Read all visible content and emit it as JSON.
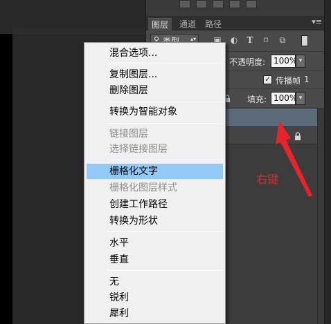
{
  "panel": {
    "tabs": [
      {
        "label": "图层",
        "active": true
      },
      {
        "label": "通道",
        "active": false
      },
      {
        "label": "路径",
        "active": false
      }
    ],
    "menu_glyph": "▾≡",
    "filter": {
      "selected": "类型",
      "icons": [
        "image-filter-icon",
        "adjustment-filter-icon",
        "type-filter-icon",
        "shape-filter-icon",
        "smart-object-filter-icon"
      ]
    },
    "opacity": {
      "label": "不透明度:",
      "value": "100%"
    },
    "propagate": {
      "label": "传播帧",
      "frame": "1",
      "checked": true
    },
    "fill": {
      "label": "填充:",
      "value": "100%"
    }
  },
  "context_menu": {
    "hover_color": "#91c9f7",
    "items": [
      {
        "label": "混合选项...",
        "enabled": true
      },
      {
        "label": "复制图层...",
        "enabled": true
      },
      {
        "label": "删除图层",
        "enabled": true
      },
      {
        "label": "转换为智能对象",
        "enabled": true
      },
      {
        "label": "链接图层",
        "enabled": false
      },
      {
        "label": "选择链接图层",
        "enabled": false
      },
      {
        "label": "栅格化文字",
        "enabled": true,
        "highlighted": true
      },
      {
        "label": "栅格化图层样式",
        "enabled": false
      },
      {
        "label": "创建工作路径",
        "enabled": true
      },
      {
        "label": "转换为形状",
        "enabled": true
      },
      {
        "label": "水平",
        "enabled": true
      },
      {
        "label": "垂直",
        "enabled": true
      },
      {
        "label": "无",
        "enabled": true
      },
      {
        "label": "锐利",
        "enabled": true
      },
      {
        "label": "犀利",
        "enabled": true
      }
    ]
  },
  "annotation": {
    "text": "右键",
    "color": "#e8242a"
  }
}
